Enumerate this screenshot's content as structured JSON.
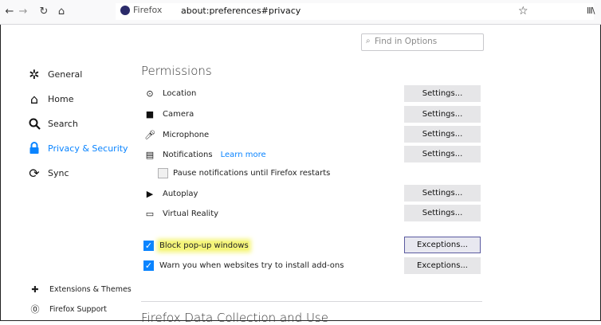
{
  "toolbar": {
    "back": "←",
    "forward": "→",
    "reload": "↻",
    "home": "⌂",
    "identity_label": "Firefox",
    "url": "about:preferences#privacy",
    "bookmark_star": "☆",
    "library": "III\\"
  },
  "search": {
    "placeholder": "Find in Options"
  },
  "sidebar": {
    "items": [
      {
        "label": "General",
        "icon": "gear-icon"
      },
      {
        "label": "Home",
        "icon": "home-icon"
      },
      {
        "label": "Search",
        "icon": "search-icon"
      },
      {
        "label": "Privacy & Security",
        "icon": "lock-icon",
        "selected": true
      },
      {
        "label": "Sync",
        "icon": "sync-icon"
      }
    ],
    "footer": [
      {
        "label": "Extensions & Themes",
        "icon": "puzzle-icon"
      },
      {
        "label": "Firefox Support",
        "icon": "help-icon"
      }
    ]
  },
  "permissions": {
    "heading": "Permissions",
    "items": [
      {
        "label": "Location",
        "button": "Settings..."
      },
      {
        "label": "Camera",
        "button": "Settings..."
      },
      {
        "label": "Microphone",
        "button": "Settings..."
      },
      {
        "label": "Notifications",
        "link": "Learn more",
        "button": "Settings..."
      },
      {
        "label": "Autoplay",
        "button": "Settings..."
      },
      {
        "label": "Virtual Reality",
        "button": "Settings..."
      }
    ],
    "pause_notifications": {
      "label": "Pause notifications until Firefox restarts",
      "checked": false
    },
    "block_popups": {
      "label": "Block pop-up windows",
      "checked": true,
      "button": "Exceptions..."
    },
    "warn_addons": {
      "label": "Warn you when websites try to install add-ons",
      "checked": true,
      "button": "Exceptions..."
    }
  },
  "next_section": {
    "heading": "Firefox Data Collection and Use"
  },
  "colors": {
    "accent": "#0a84ff",
    "highlight": "#f5f57a"
  }
}
